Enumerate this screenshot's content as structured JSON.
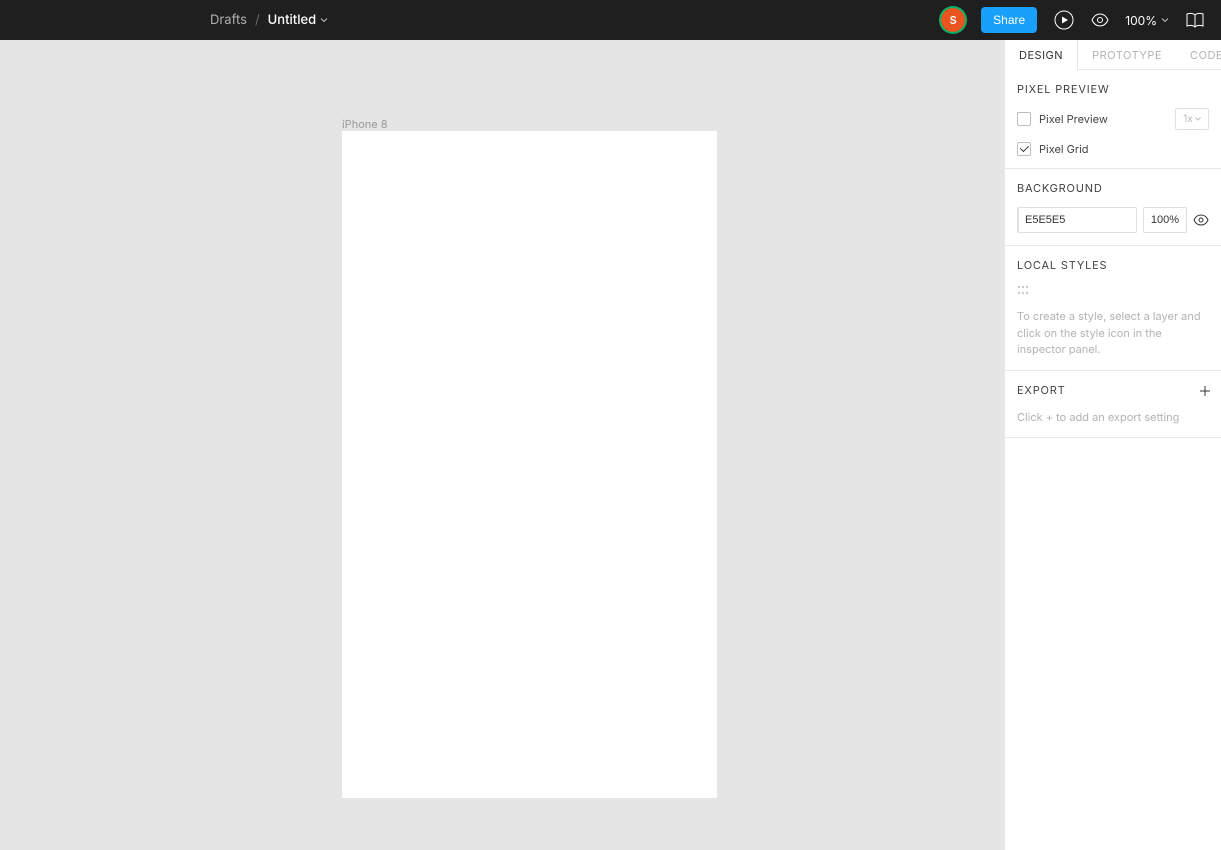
{
  "header": {
    "location": "Drafts",
    "separator": "/",
    "title": "Untitled",
    "avatar_initial": "S",
    "share_label": "Share",
    "zoom_label": "100%"
  },
  "canvas": {
    "frame_label": "iPhone 8"
  },
  "panel": {
    "tabs": {
      "design": "DESIGN",
      "prototype": "PROTOTYPE",
      "code": "CODE"
    },
    "pixel_preview": {
      "title": "PIXEL PREVIEW",
      "preview_label": "Pixel Preview",
      "grid_label": "Pixel Grid",
      "scale_label": "1x"
    },
    "background": {
      "title": "BACKGROUND",
      "hex": "E5E5E5",
      "opacity": "100%"
    },
    "local_styles": {
      "title": "LOCAL STYLES",
      "hint": "To create a style, select a layer and click on the style icon in the inspector panel."
    },
    "export": {
      "title": "EXPORT",
      "hint": "Click + to add an export setting"
    }
  }
}
